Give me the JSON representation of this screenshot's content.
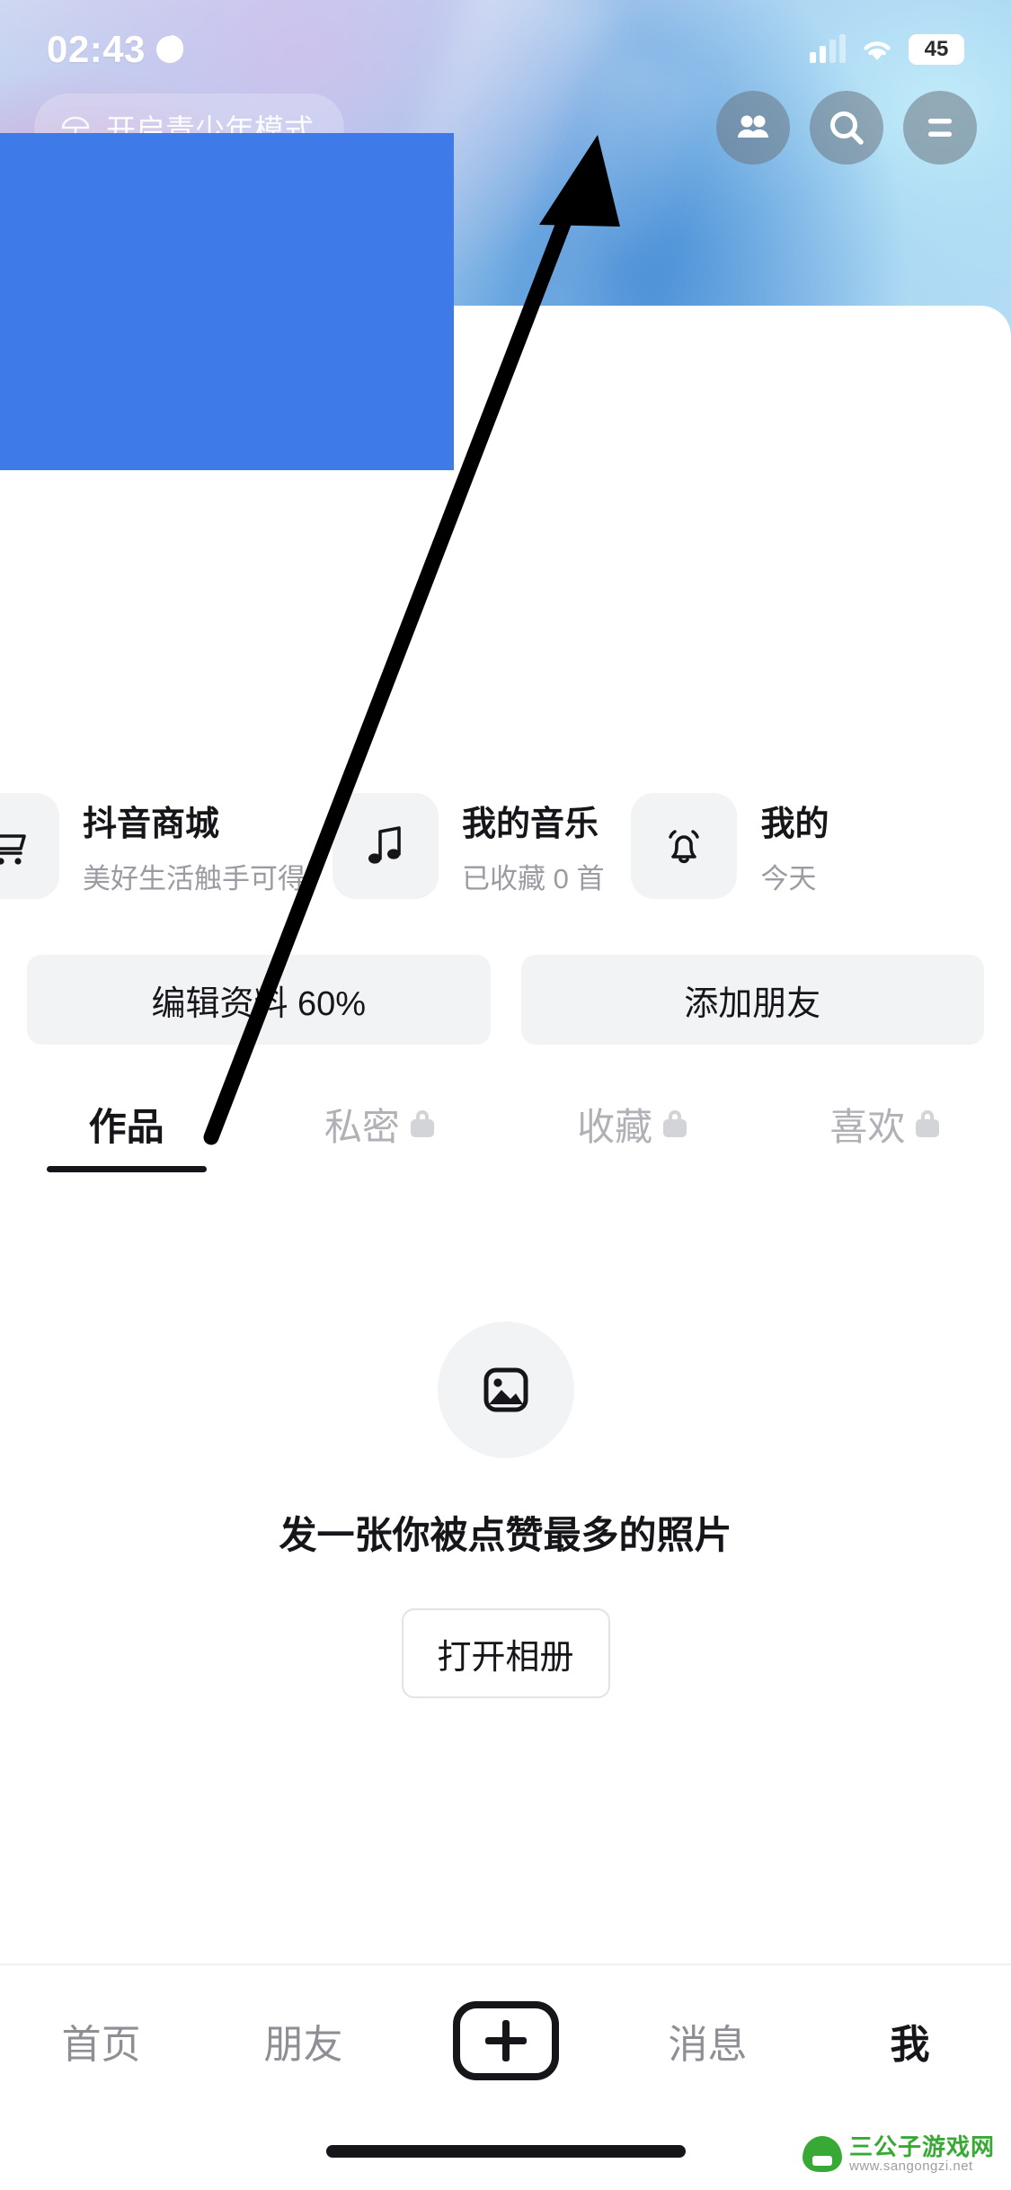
{
  "status_bar": {
    "time": "02:43",
    "moon_icon": "moon-icon",
    "signal_icon": "signal-bars-icon",
    "wifi_icon": "wifi-icon",
    "battery_level": "45"
  },
  "header": {
    "teen_mode": {
      "icon": "umbrella-icon",
      "label": "开启青少年模式"
    },
    "actions": [
      {
        "name": "friends-icon",
        "label": "朋友"
      },
      {
        "name": "search-icon",
        "label": "搜索"
      },
      {
        "name": "menu-icon",
        "label": "菜单"
      }
    ]
  },
  "quick_cards": [
    {
      "icon": "shopping-cart-icon",
      "title": "抖音商城",
      "subtitle": "美好生活触手可得"
    },
    {
      "icon": "music-note-icon",
      "title": "我的音乐",
      "subtitle": "已收藏 0 首"
    },
    {
      "icon": "bell-icon",
      "title": "我的",
      "subtitle": "今天"
    }
  ],
  "action_buttons": [
    {
      "name": "edit-profile-button",
      "label": "编辑资料 60%"
    },
    {
      "name": "add-friend-button",
      "label": "添加朋友"
    }
  ],
  "tabs": [
    {
      "label": "作品",
      "active": true,
      "locked": false
    },
    {
      "label": "私密",
      "active": false,
      "locked": true
    },
    {
      "label": "收藏",
      "active": false,
      "locked": true
    },
    {
      "label": "喜欢",
      "active": false,
      "locked": true
    }
  ],
  "empty_state": {
    "icon": "photo-icon",
    "message": "发一张你被点赞最多的照片",
    "button_label": "打开相册"
  },
  "bottom_nav": [
    {
      "label": "首页",
      "active": false
    },
    {
      "label": "朋友",
      "active": false
    },
    {
      "label": "",
      "active": false,
      "icon": "plus-icon"
    },
    {
      "label": "消息",
      "active": false
    },
    {
      "label": "我",
      "active": true
    }
  ],
  "watermark": {
    "title": "三公子游戏网",
    "url": "www.sangongzi.net"
  },
  "annotations": {
    "blue_rect_color": "#3e7ae8",
    "arrow_color": "#000000"
  }
}
